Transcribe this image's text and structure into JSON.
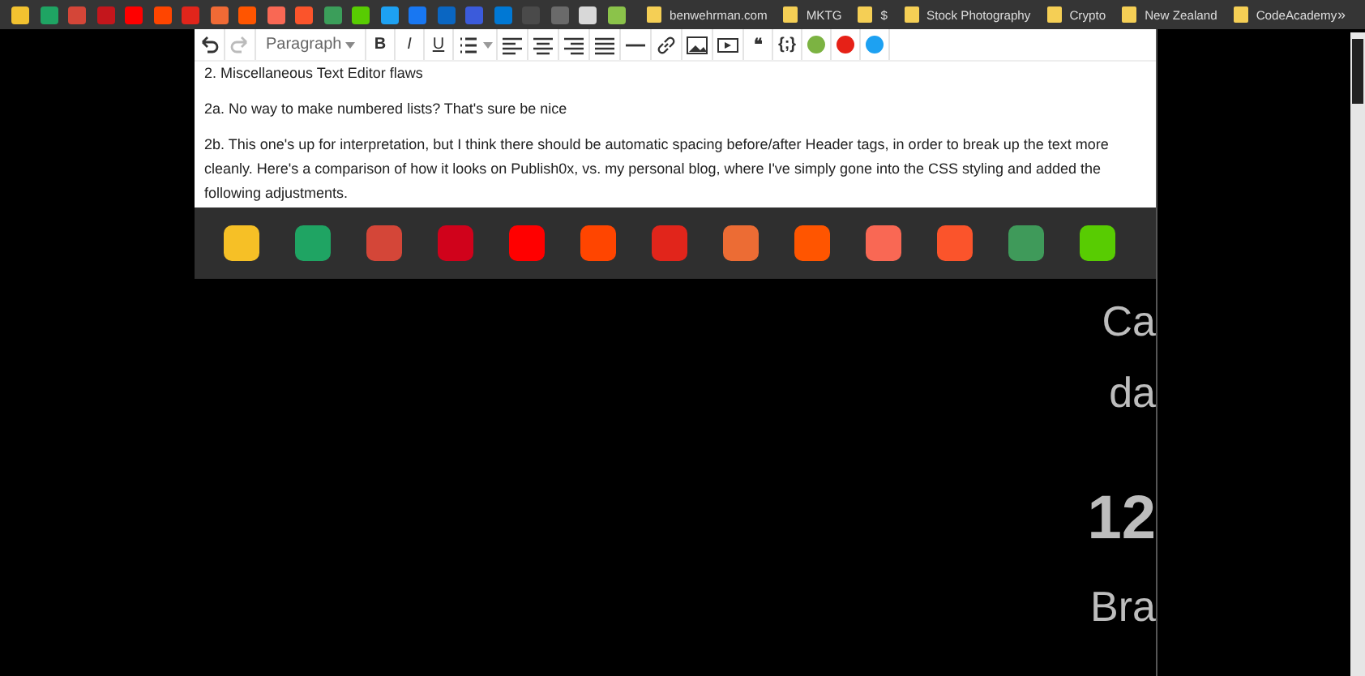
{
  "bookmarks_bar": {
    "icons": [
      {
        "color": "#f2c230"
      },
      {
        "color": "#1fa463"
      },
      {
        "color": "#d44638"
      },
      {
        "color": "#c4161c"
      },
      {
        "color": "#ff0000"
      },
      {
        "color": "#ff4500"
      },
      {
        "color": "#e1251b"
      },
      {
        "color": "#f06a35"
      },
      {
        "color": "#ff5500"
      },
      {
        "color": "#f96854"
      },
      {
        "color": "#fb542b"
      },
      {
        "color": "#3b9e5a"
      },
      {
        "color": "#58cc02"
      },
      {
        "color": "#1da1f2"
      },
      {
        "color": "#1877f2"
      },
      {
        "color": "#0a66c2"
      },
      {
        "color": "#3b5bdb"
      },
      {
        "color": "#0078d4"
      },
      {
        "color": "#4a4a4a"
      },
      {
        "color": "#6a6a6a"
      },
      {
        "color": "#d8d8d8"
      },
      {
        "color": "#8bc34a"
      }
    ],
    "links": [
      {
        "label": "benwehrman.com"
      },
      {
        "label": "MKTG"
      },
      {
        "label": "$"
      },
      {
        "label": "Stock Photography"
      },
      {
        "label": "Crypto"
      },
      {
        "label": "New Zealand"
      },
      {
        "label": "CodeAcademy"
      }
    ],
    "overflow": "»"
  },
  "editor": {
    "toolbar": [
      {
        "kind": "undo",
        "disabled": false
      },
      {
        "kind": "redo",
        "disabled": true
      },
      {
        "kind": "format",
        "label": "Paragraph"
      },
      {
        "kind": "bold",
        "label": "B"
      },
      {
        "kind": "italic",
        "label": "I"
      },
      {
        "kind": "underline",
        "label": "U"
      },
      {
        "kind": "list"
      },
      {
        "kind": "align-left"
      },
      {
        "kind": "align-center"
      },
      {
        "kind": "align-right"
      },
      {
        "kind": "justify"
      },
      {
        "kind": "rule"
      },
      {
        "kind": "link"
      },
      {
        "kind": "image"
      },
      {
        "kind": "media"
      },
      {
        "kind": "quote",
        "label": "❝"
      },
      {
        "kind": "code",
        "label": "{;}"
      },
      {
        "kind": "dot",
        "color": "#7cb342"
      },
      {
        "kind": "dot",
        "color": "#e62117"
      },
      {
        "kind": "dot",
        "color": "#1da1f2"
      }
    ],
    "paragraphs": [
      "2. Miscellaneous Text Editor flaws",
      "2a. No way to make numbered lists? That's sure be nice",
      "2b. This one's up for interpretation, but I think there should be automatic spacing before/after Header tags, in order to break up the text more cleanly. Here's a comparison of how it looks on Publish0x, vs. my personal blog, where I've simply gone into the CSS styling and added the following adjustments."
    ]
  },
  "dock": {
    "apps": [
      {
        "color": "#f6c026"
      },
      {
        "color": "#1fa463"
      },
      {
        "color": "#d44638"
      },
      {
        "color": "#d0021b"
      },
      {
        "color": "#ff0000"
      },
      {
        "color": "#ff4500"
      },
      {
        "color": "#e1251b"
      },
      {
        "color": "#ec6c34"
      },
      {
        "color": "#ff5500"
      },
      {
        "color": "#f96854"
      },
      {
        "color": "#fb542b"
      },
      {
        "color": "#3f9a5a"
      },
      {
        "color": "#58cc02"
      }
    ]
  },
  "preview": {
    "lines": [
      {
        "kind": "text",
        "text": "Ca"
      },
      {
        "kind": "text",
        "text": "da"
      },
      {
        "kind": "heading",
        "text": "12"
      },
      {
        "kind": "text",
        "text": "Bra"
      }
    ]
  }
}
